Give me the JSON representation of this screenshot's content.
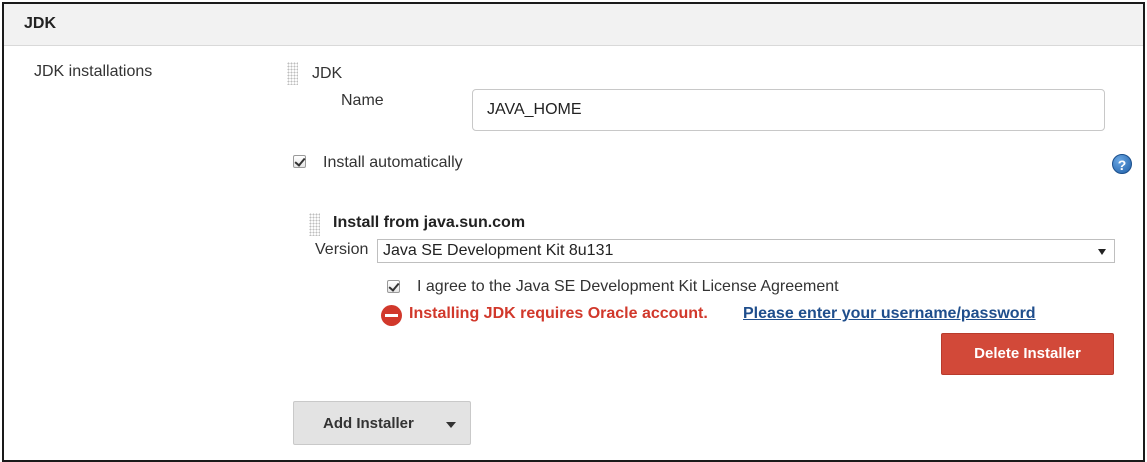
{
  "section": {
    "title": "JDK"
  },
  "jdk_installations": {
    "label": "JDK installations",
    "item_title": "JDK",
    "name_label": "Name",
    "name_value": "JAVA_HOME",
    "install_automatically_label": "Install automatically",
    "install_automatically_checked": true,
    "help_icon": "question-mark-icon",
    "installer": {
      "title": "Install from java.sun.com",
      "version_label": "Version",
      "version_selected": "Java SE Development Kit 8u131",
      "license_label": "I agree to the Java SE Development Kit License Agreement",
      "license_checked": true,
      "error_message": "Installing JDK requires Oracle account.",
      "error_link": "Please enter your username/password",
      "delete_button_label": "Delete Installer"
    },
    "add_installer_label": "Add Installer"
  },
  "colors": {
    "error": "#d1382b",
    "link": "#1f4e8c",
    "delete_button": "#d24939",
    "header_background": "#f2f2f2"
  }
}
